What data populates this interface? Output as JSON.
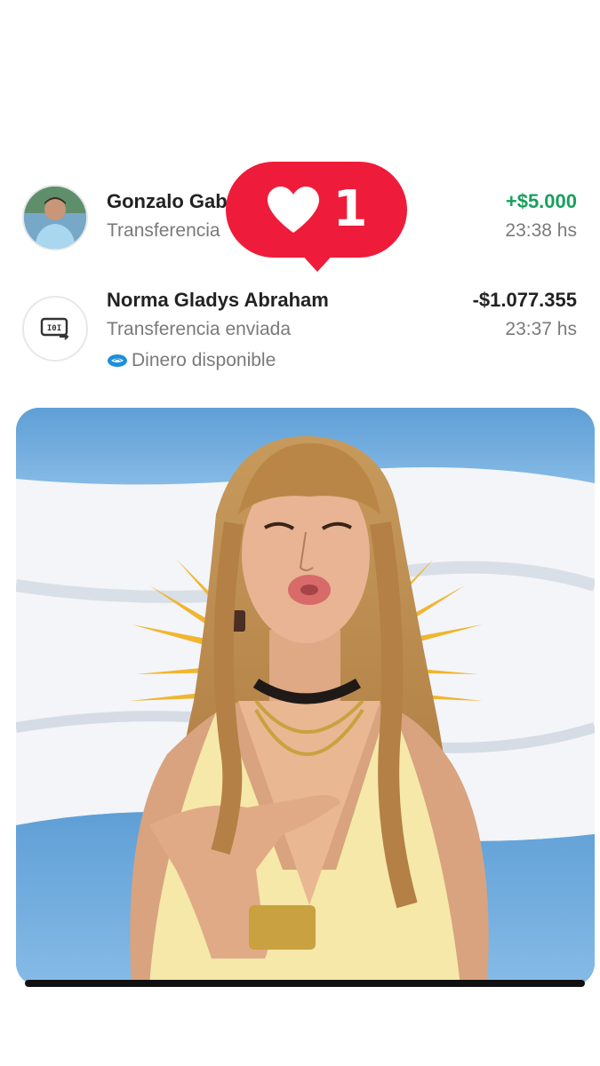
{
  "notification": {
    "like_count": "1"
  },
  "transactions": [
    {
      "name": "Gonzalo Gab",
      "subtitle": "Transferencia",
      "amount": "+$5.000",
      "time": "23:38 hs",
      "amount_color": "#17a05d",
      "avatar": "profile-photo"
    },
    {
      "name": "Norma Gladys Abraham",
      "subtitle": "Transferencia enviada",
      "amount": "-$1.077.355",
      "time": "23:37 hs",
      "amount_color": "#222222",
      "avatar": "transfer-icon",
      "note": "Dinero disponible"
    }
  ],
  "colors": {
    "like_red": "#ef1b3a",
    "positive_green": "#17a05d",
    "flag_blue": "#74acdf",
    "flag_white": "#ffffff",
    "sun_gold": "#f6b40e"
  }
}
